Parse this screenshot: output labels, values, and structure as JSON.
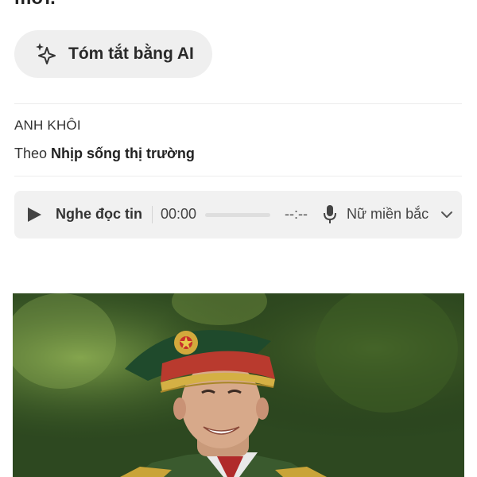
{
  "header": {
    "cut_text": "mới."
  },
  "ai_summary": {
    "icon": "sparkle-icon",
    "label": "Tóm tắt bằng AI"
  },
  "byline": {
    "author": "ANH KHÔI",
    "source_prefix": "Theo ",
    "source_name": "Nhịp sống thị trường"
  },
  "audio_player": {
    "play_icon": "play-icon",
    "label": "Nghe đọc tin",
    "current_time": "00:00",
    "duration": "--:--",
    "progress": 0,
    "mic_icon": "microphone-icon",
    "voice": "Nữ miền bắc",
    "dropdown_icon": "chevron-down-icon"
  },
  "colors": {
    "pill_bg": "#efefef",
    "player_bg": "#f1f1f1",
    "text": "#222222"
  }
}
